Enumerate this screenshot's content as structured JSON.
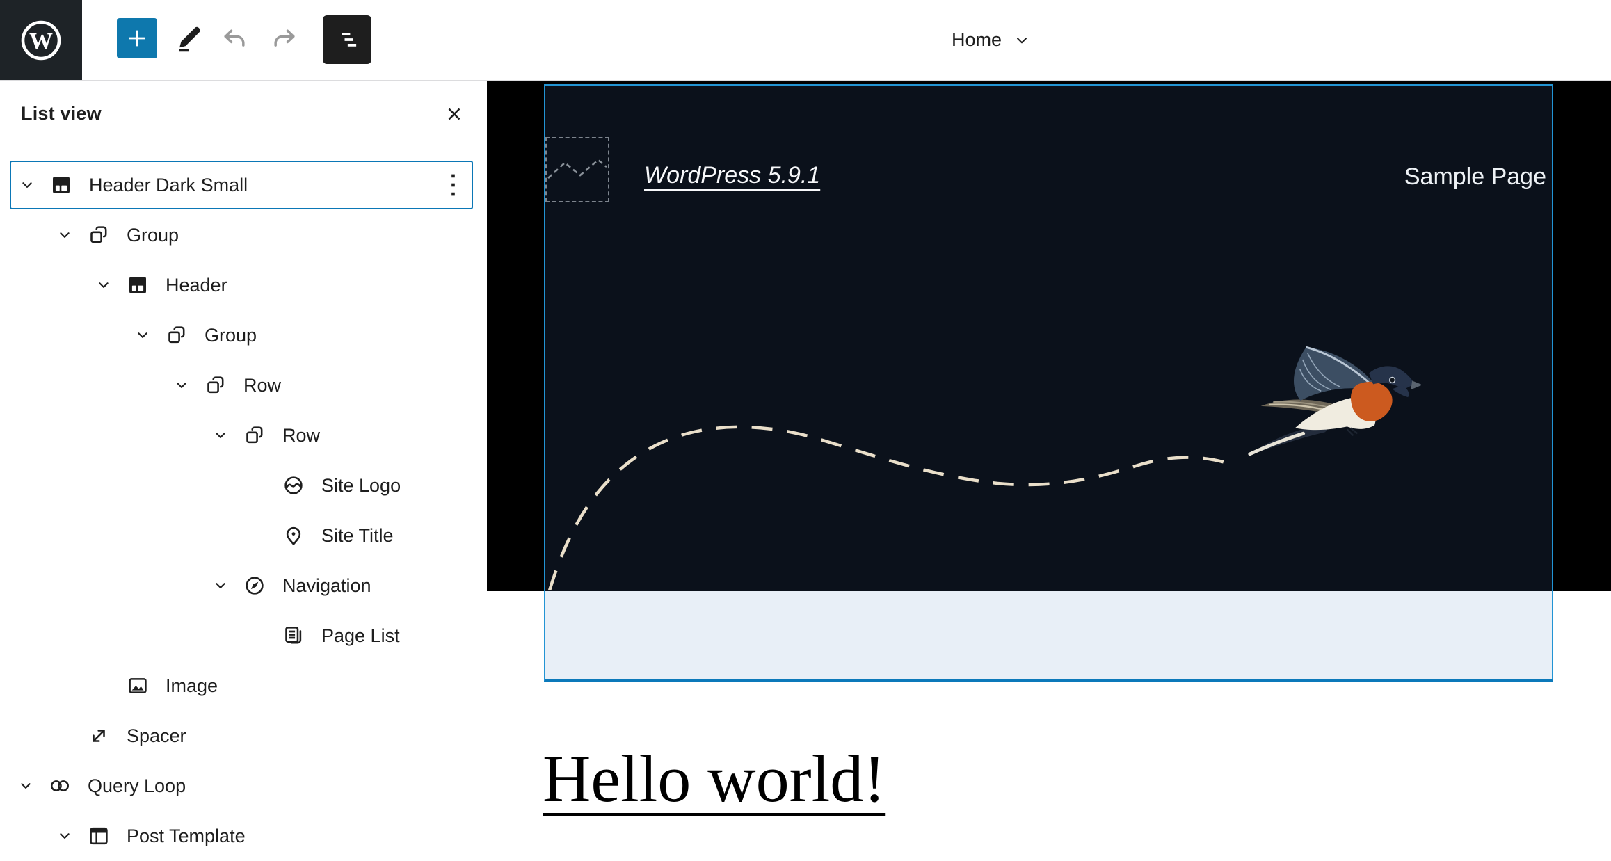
{
  "toolbar": {
    "home_label": "Home",
    "buttons": [
      "inserter",
      "edit-mode",
      "undo",
      "redo",
      "list-view"
    ]
  },
  "list_view": {
    "title": "List view",
    "close_icon": "close-icon",
    "items": [
      {
        "label": "Header Dark Small",
        "icon": "template-part-icon",
        "level": 0,
        "expanded": true,
        "selected": true,
        "has_menu": true
      },
      {
        "label": "Group",
        "icon": "group-icon",
        "level": 1,
        "expanded": true
      },
      {
        "label": "Header",
        "icon": "header-icon",
        "level": 2,
        "expanded": true
      },
      {
        "label": "Group",
        "icon": "group-icon",
        "level": 3,
        "expanded": true
      },
      {
        "label": "Row",
        "icon": "row-icon",
        "level": 4,
        "expanded": true
      },
      {
        "label": "Row",
        "icon": "row-icon",
        "level": 5,
        "expanded": true
      },
      {
        "label": "Site Logo",
        "icon": "site-logo-icon",
        "level": 6,
        "expanded": false
      },
      {
        "label": "Site Title",
        "icon": "site-title-icon",
        "level": 6,
        "expanded": false
      },
      {
        "label": "Navigation",
        "icon": "navigation-icon",
        "level": 5,
        "expanded": true
      },
      {
        "label": "Page List",
        "icon": "page-list-icon",
        "level": 6,
        "expanded": false
      },
      {
        "label": "Image",
        "icon": "image-icon",
        "level": 2,
        "expanded": false
      },
      {
        "label": "Spacer",
        "icon": "spacer-icon",
        "level": 1,
        "expanded": false
      },
      {
        "label": "Query Loop",
        "icon": "query-loop-icon",
        "level": 0,
        "expanded": true
      },
      {
        "label": "Post Template",
        "icon": "post-template-icon",
        "level": 1,
        "expanded": true
      }
    ]
  },
  "canvas": {
    "site_title": "WordPress 5.9.1",
    "nav_item": "Sample Page",
    "post_title": "Hello world!"
  },
  "colors": {
    "admin_blue": "#0b77b6",
    "inserter_blue": "#0e78ad",
    "selection_border": "#2294d4",
    "selection_border_bottom": "#0c79ba",
    "header_background": "#0b111b",
    "outer_background": "#000000",
    "spacer_highlight": "#e8eff7",
    "flight_path": "#eadfca",
    "bird_chest": "#cc5a1f",
    "bird_wing": "#3c4e63"
  }
}
